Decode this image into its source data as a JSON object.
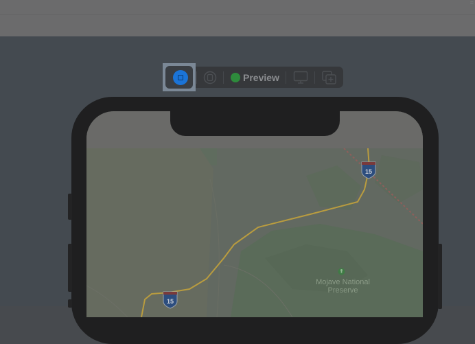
{
  "window": {
    "corner_glyph": "≡"
  },
  "toolbar": {
    "live_button": {
      "icon": "stop-square-icon",
      "color": "#1b74d7",
      "selected": true
    },
    "variants_button": {
      "icon": "variants-icon"
    },
    "preview_label": "Preview",
    "preview_status_color": "#2e8b3c",
    "device_button": {
      "icon": "device-settings-icon"
    },
    "duplicate_button": {
      "icon": "duplicate-icon"
    }
  },
  "map": {
    "poi_name_line1": "Mojave National",
    "poi_name_line2": "Preserve",
    "highway_shields": [
      "15",
      "15"
    ],
    "route_color": "#b99c3f"
  }
}
